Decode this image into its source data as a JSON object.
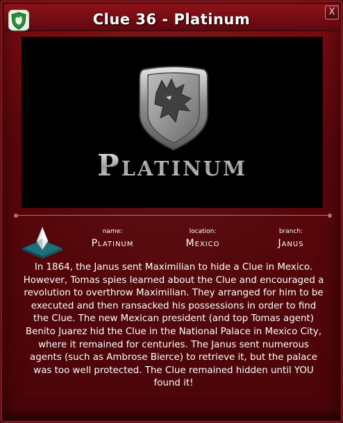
{
  "window": {
    "title": "Clue 36 - Platinum",
    "close_label": "X"
  },
  "hero": {
    "word": "Platinum",
    "emblem_icon": "wolf-shield-icon"
  },
  "info": {
    "gem_icon": "platinum-gem-icon",
    "name_label": "name:",
    "name_value": "Platinum",
    "location_label": "location:",
    "location_value": "Mexico",
    "branch_label": "branch:",
    "branch_value": "Janus"
  },
  "description": "In 1864, the Janus sent Maximilian to hide a Clue in Mexico. However, Tomas spies learned about the Clue and encouraged a revolution to overthrow Maximilian. They arranged for him to be executed and then ransacked his possessions in order to find the Clue. The new Mexican president (and top Tomas agent) Benito Juarez hid the Clue in the National Palace in Mexico City, where it remained for centuries. The Janus sent numerous agents (such as Ambrose Bierce) to retrieve it, but the palace was too well protected. The Clue remained hidden until YOU found it!",
  "colors": {
    "frame": "#5a070b",
    "titlebar": "#8e1219",
    "text": "#ffffff",
    "badge_green": "#2f8a3a"
  }
}
